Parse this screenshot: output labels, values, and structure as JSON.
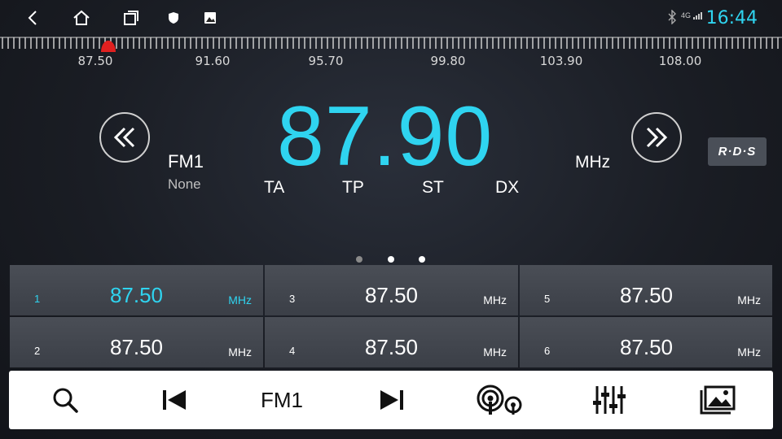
{
  "status_bar": {
    "icons": [
      "back-icon",
      "home-icon",
      "recent-apps-icon",
      "shield-icon",
      "image-icon",
      "bluetooth-icon",
      "signal-icon"
    ],
    "network": "4G",
    "time": "16:44"
  },
  "tuning_scale": {
    "labels": [
      "87.50",
      "91.60",
      "95.70",
      "99.80",
      "103.90",
      "108.00"
    ],
    "marker_color": "#e02020"
  },
  "radio": {
    "band": "FM1",
    "ps_name": "None",
    "frequency": "87.90",
    "unit": "MHz",
    "flags": [
      "TA",
      "TP",
      "ST",
      "DX"
    ],
    "rds_label": "R·D·S",
    "prev_icon": "seek-back-icon",
    "next_icon": "seek-forward-icon"
  },
  "page_indicator": {
    "count": 3,
    "active": 0
  },
  "presets": [
    {
      "index": "1",
      "freq": "87.50",
      "unit": "MHz",
      "active": true
    },
    {
      "index": "2",
      "freq": "87.50",
      "unit": "MHz",
      "active": false
    },
    {
      "index": "3",
      "freq": "87.50",
      "unit": "MHz",
      "active": false
    },
    {
      "index": "4",
      "freq": "87.50",
      "unit": "MHz",
      "active": false
    },
    {
      "index": "5",
      "freq": "87.50",
      "unit": "MHz",
      "active": false
    },
    {
      "index": "6",
      "freq": "87.50",
      "unit": "MHz",
      "active": false
    }
  ],
  "toolbar": {
    "search_icon": "search-icon",
    "prev_icon": "skip-previous-icon",
    "band_label": "FM1",
    "next_icon": "skip-next-icon",
    "scan_icon": "broadcast-icon",
    "eq_icon": "equalizer-icon",
    "gallery_icon": "gallery-icon"
  },
  "colors": {
    "accent": "#2fd4f0",
    "text": "#ffffff",
    "muted": "#bfbfbf",
    "preset_bg": "#43474f",
    "toolbar_bg": "#ffffff"
  }
}
